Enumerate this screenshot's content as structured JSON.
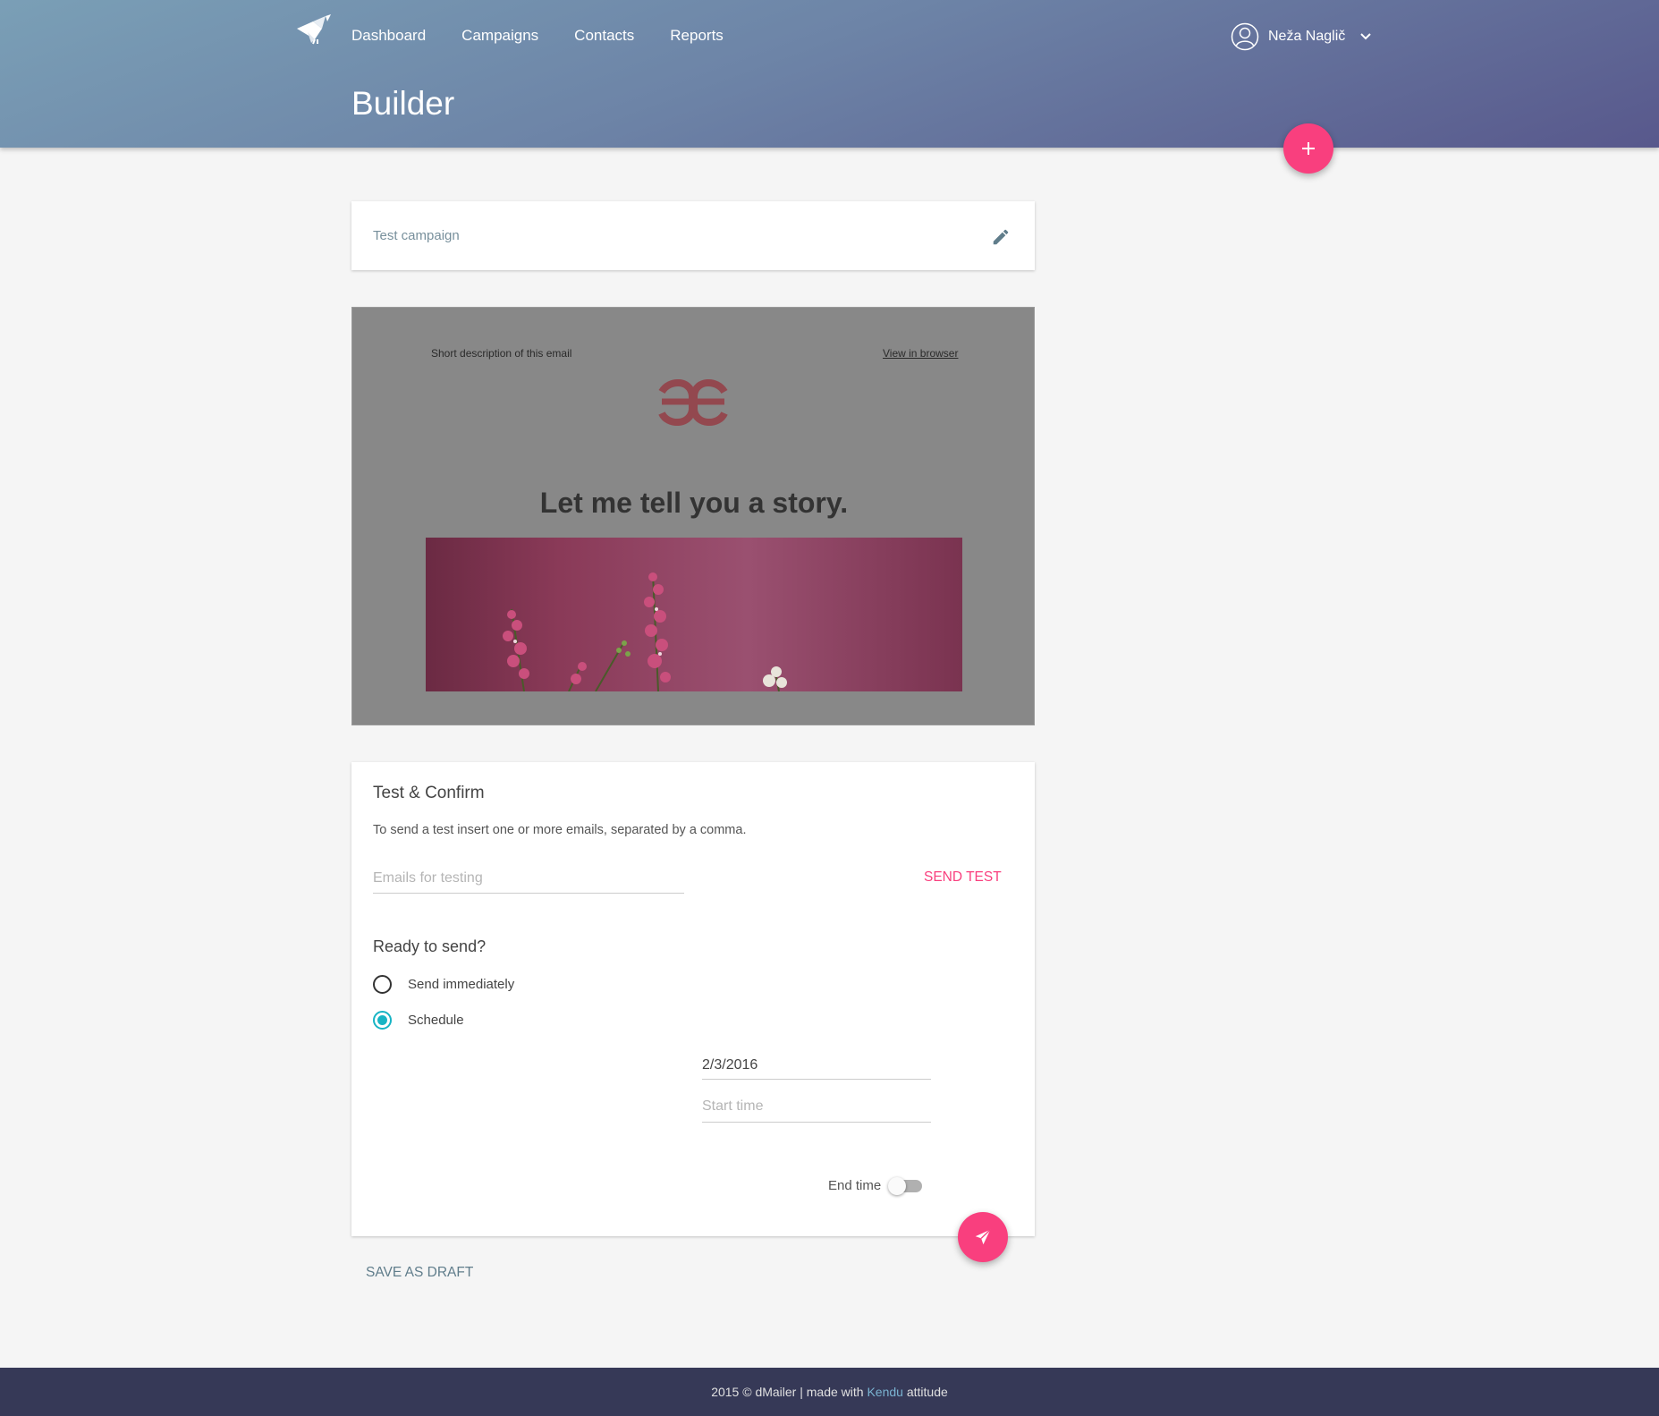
{
  "nav": {
    "items": [
      "Dashboard",
      "Campaigns",
      "Contacts",
      "Reports"
    ],
    "logo_icon": "bird-icon"
  },
  "user": {
    "name": "Neža Naglič",
    "avatar_icon": "user-circle-icon",
    "menu_icon": "chevron-down-icon"
  },
  "page": {
    "title": "Builder"
  },
  "fab_add": {
    "label": "+"
  },
  "campaign": {
    "name": "Test campaign",
    "edit_icon": "pencil-icon"
  },
  "preview": {
    "description": "Short description of this email",
    "view_in_browser": "View in browser",
    "logo_text": "ɘe",
    "headline": "Let me tell you a story."
  },
  "confirm": {
    "heading": "Test & Confirm",
    "hint": "To send a test insert one or more emails, separated by a comma.",
    "emails_placeholder": "Emails for testing",
    "send_test_label": "SEND TEST",
    "ready_heading": "Ready to send?",
    "options": [
      {
        "label": "Send immediately",
        "checked": false
      },
      {
        "label": "Schedule",
        "checked": true
      }
    ],
    "date_value": "2/3/2016",
    "start_time_placeholder": "Start time",
    "end_time_label": "End time",
    "end_time_enabled": false
  },
  "actions": {
    "save_draft": "SAVE AS DRAFT",
    "send_icon": "paper-plane-icon"
  },
  "footer": {
    "prefix": "2015 © dMailer | made with ",
    "brand": "Kendu",
    "suffix": " attitude"
  },
  "colors": {
    "accent": "#f93f7e",
    "radio": "#17b4c4",
    "footer_bg": "#363957",
    "link": "#7ab3d1"
  }
}
